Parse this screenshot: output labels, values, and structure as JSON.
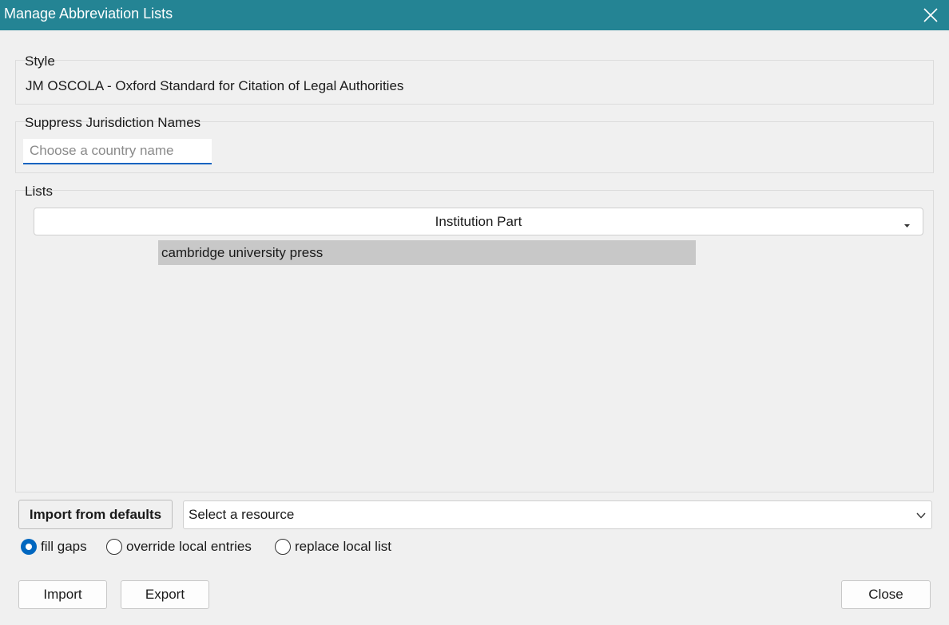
{
  "window": {
    "title": "Manage Abbreviation Lists",
    "close_icon": "close-icon"
  },
  "style_group": {
    "label": "Style",
    "value": "JM OSCOLA - Oxford Standard for Citation of Legal Authorities"
  },
  "jurisdiction_group": {
    "label": "Suppress Jurisdiction Names",
    "input_value": "",
    "input_placeholder": "Choose a country name"
  },
  "lists_group": {
    "label": "Lists",
    "selected_list": "Institution Part",
    "entries": [
      "cambridge university press"
    ]
  },
  "import_defaults": {
    "button_label": "Import from defaults",
    "resource_placeholder": "Select a resource",
    "options": [
      {
        "label": "fill gaps",
        "checked": true
      },
      {
        "label": "override local entries",
        "checked": false
      },
      {
        "label": "replace local list",
        "checked": false
      }
    ]
  },
  "footer": {
    "import_label": "Import",
    "export_label": "Export",
    "close_label": "Close"
  },
  "colors": {
    "titlebar": "#248494",
    "accent": "#0067c0",
    "selected_entry": "#c8c8c8"
  }
}
